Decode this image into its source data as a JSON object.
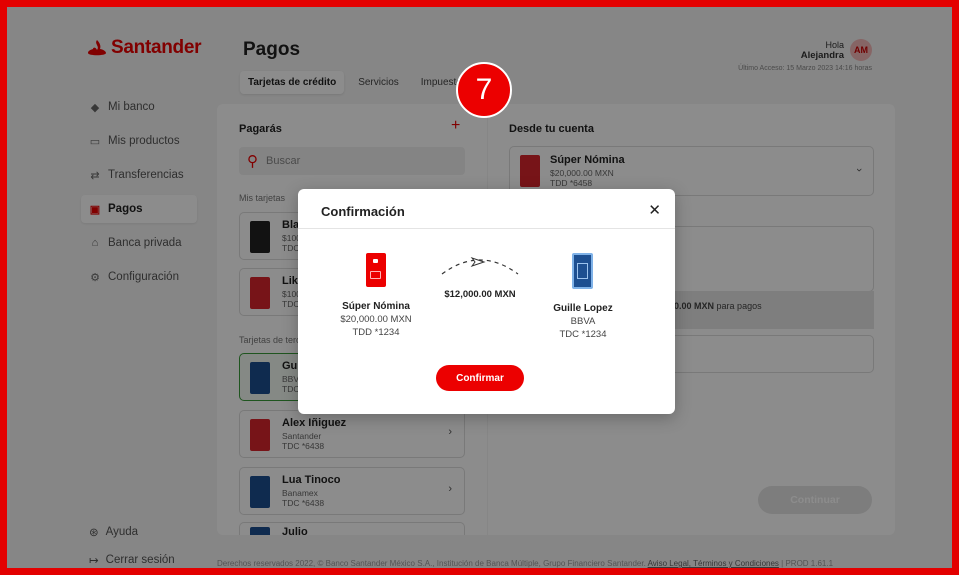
{
  "brand": {
    "name": "Santander",
    "color": "#ec0000"
  },
  "header": {
    "title": "Pagos",
    "tabs": [
      {
        "label": "Tarjetas de crédito",
        "active": true
      },
      {
        "label": "Servicios",
        "active": false
      },
      {
        "label": "Impuestos",
        "active": false
      }
    ],
    "user": {
      "greeting": "Hola",
      "name": "Alejandra",
      "initials": "AM"
    },
    "last_access": "Último Acceso: 15 Marzo 2023 14:16 horas"
  },
  "sidebar": {
    "items": [
      {
        "label": "Mi banco",
        "icon": "bank-icon",
        "active": false
      },
      {
        "label": "Mis productos",
        "icon": "card-icon",
        "active": false
      },
      {
        "label": "Transferencias",
        "icon": "transfer-icon",
        "active": false
      },
      {
        "label": "Pagos",
        "icon": "payment-icon",
        "active": true
      },
      {
        "label": "Banca privada",
        "icon": "building-icon",
        "active": false
      },
      {
        "label": "Configuración",
        "icon": "gear-icon",
        "active": false
      }
    ],
    "help": "Ayuda",
    "logout": "Cerrar sesión"
  },
  "left_panel": {
    "title": "Pagarás",
    "search_placeholder": "Buscar",
    "my_cards_label": "Mis tarjetas",
    "my_cards": [
      {
        "name": "Black",
        "line1": "$100",
        "line2": "TDC",
        "color": "#222222"
      },
      {
        "name": "Like",
        "line1": "$100",
        "line2": "TDC",
        "color": "#d9262c"
      }
    ],
    "third_party_label": "Tarjetas de terceros",
    "third_party": [
      {
        "name": "Guille",
        "line1": "BBVA",
        "line2": "TDC",
        "color": "#1d4f91",
        "selected": true
      },
      {
        "name": "Alex Iñiguez",
        "line1": "Santander",
        "line2": "TDC *6438",
        "color": "#d9262c",
        "selected": false
      },
      {
        "name": "Lua Tinoco",
        "line1": "Banamex",
        "line2": "TDC *6438",
        "color": "#1d4f91",
        "selected": false
      },
      {
        "name": "Julio",
        "line1": "",
        "line2": "",
        "color": "#1d4f91",
        "selected": false
      }
    ]
  },
  "right_panel": {
    "title": "Desde tu cuenta",
    "account": {
      "name": "Súper Nómina",
      "balance": "$20,000.00 MXN",
      "number": "TDD *6458"
    },
    "available_text_bold": "0.00 MXN",
    "available_text": "para pagos",
    "continue_label": "Continuar"
  },
  "footer": {
    "text": "Derechos reservados 2022, © Banco Santander México S.A., Institución de Banca Múltiple, Grupo Financiero Santander.",
    "link": "Aviso Legal, Términos y Condiciones",
    "version": "| PROD 1.61.1"
  },
  "modal": {
    "title": "Confirmación",
    "from": {
      "name": "Súper Nómina",
      "balance": "$20,000.00 MXN",
      "number": "TDD *1234"
    },
    "amount": "$12,000.00 MXN",
    "to": {
      "name": "Guille Lopez",
      "bank": "BBVA",
      "number": "TDC *1234"
    },
    "confirm_label": "Confirmar"
  },
  "step_badge": "7"
}
